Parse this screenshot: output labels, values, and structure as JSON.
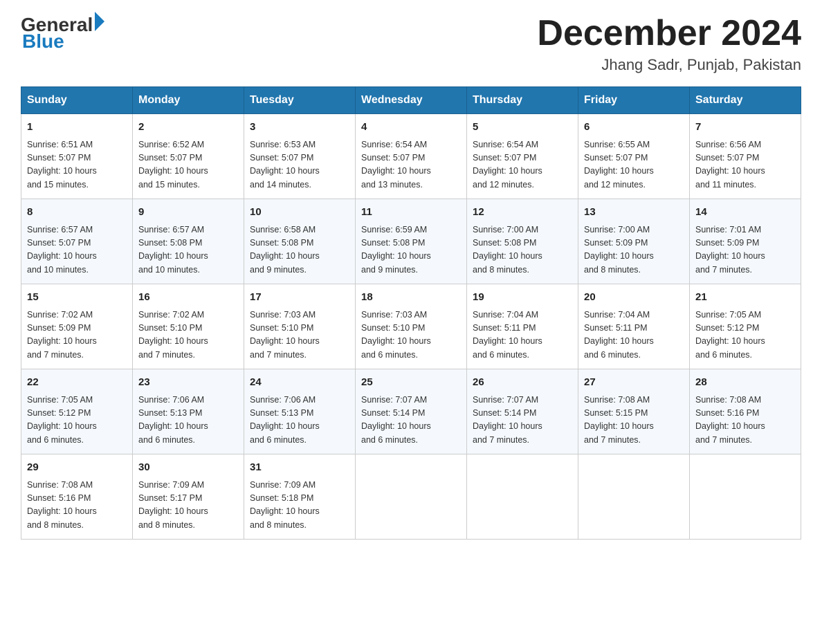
{
  "header": {
    "logo_general": "General",
    "logo_blue": "Blue",
    "month_year": "December 2024",
    "location": "Jhang Sadr, Punjab, Pakistan"
  },
  "days_of_week": [
    "Sunday",
    "Monday",
    "Tuesday",
    "Wednesday",
    "Thursday",
    "Friday",
    "Saturday"
  ],
  "weeks": [
    [
      {
        "day": "1",
        "info": "Sunrise: 6:51 AM\nSunset: 5:07 PM\nDaylight: 10 hours\nand 15 minutes."
      },
      {
        "day": "2",
        "info": "Sunrise: 6:52 AM\nSunset: 5:07 PM\nDaylight: 10 hours\nand 15 minutes."
      },
      {
        "day": "3",
        "info": "Sunrise: 6:53 AM\nSunset: 5:07 PM\nDaylight: 10 hours\nand 14 minutes."
      },
      {
        "day": "4",
        "info": "Sunrise: 6:54 AM\nSunset: 5:07 PM\nDaylight: 10 hours\nand 13 minutes."
      },
      {
        "day": "5",
        "info": "Sunrise: 6:54 AM\nSunset: 5:07 PM\nDaylight: 10 hours\nand 12 minutes."
      },
      {
        "day": "6",
        "info": "Sunrise: 6:55 AM\nSunset: 5:07 PM\nDaylight: 10 hours\nand 12 minutes."
      },
      {
        "day": "7",
        "info": "Sunrise: 6:56 AM\nSunset: 5:07 PM\nDaylight: 10 hours\nand 11 minutes."
      }
    ],
    [
      {
        "day": "8",
        "info": "Sunrise: 6:57 AM\nSunset: 5:07 PM\nDaylight: 10 hours\nand 10 minutes."
      },
      {
        "day": "9",
        "info": "Sunrise: 6:57 AM\nSunset: 5:08 PM\nDaylight: 10 hours\nand 10 minutes."
      },
      {
        "day": "10",
        "info": "Sunrise: 6:58 AM\nSunset: 5:08 PM\nDaylight: 10 hours\nand 9 minutes."
      },
      {
        "day": "11",
        "info": "Sunrise: 6:59 AM\nSunset: 5:08 PM\nDaylight: 10 hours\nand 9 minutes."
      },
      {
        "day": "12",
        "info": "Sunrise: 7:00 AM\nSunset: 5:08 PM\nDaylight: 10 hours\nand 8 minutes."
      },
      {
        "day": "13",
        "info": "Sunrise: 7:00 AM\nSunset: 5:09 PM\nDaylight: 10 hours\nand 8 minutes."
      },
      {
        "day": "14",
        "info": "Sunrise: 7:01 AM\nSunset: 5:09 PM\nDaylight: 10 hours\nand 7 minutes."
      }
    ],
    [
      {
        "day": "15",
        "info": "Sunrise: 7:02 AM\nSunset: 5:09 PM\nDaylight: 10 hours\nand 7 minutes."
      },
      {
        "day": "16",
        "info": "Sunrise: 7:02 AM\nSunset: 5:10 PM\nDaylight: 10 hours\nand 7 minutes."
      },
      {
        "day": "17",
        "info": "Sunrise: 7:03 AM\nSunset: 5:10 PM\nDaylight: 10 hours\nand 7 minutes."
      },
      {
        "day": "18",
        "info": "Sunrise: 7:03 AM\nSunset: 5:10 PM\nDaylight: 10 hours\nand 6 minutes."
      },
      {
        "day": "19",
        "info": "Sunrise: 7:04 AM\nSunset: 5:11 PM\nDaylight: 10 hours\nand 6 minutes."
      },
      {
        "day": "20",
        "info": "Sunrise: 7:04 AM\nSunset: 5:11 PM\nDaylight: 10 hours\nand 6 minutes."
      },
      {
        "day": "21",
        "info": "Sunrise: 7:05 AM\nSunset: 5:12 PM\nDaylight: 10 hours\nand 6 minutes."
      }
    ],
    [
      {
        "day": "22",
        "info": "Sunrise: 7:05 AM\nSunset: 5:12 PM\nDaylight: 10 hours\nand 6 minutes."
      },
      {
        "day": "23",
        "info": "Sunrise: 7:06 AM\nSunset: 5:13 PM\nDaylight: 10 hours\nand 6 minutes."
      },
      {
        "day": "24",
        "info": "Sunrise: 7:06 AM\nSunset: 5:13 PM\nDaylight: 10 hours\nand 6 minutes."
      },
      {
        "day": "25",
        "info": "Sunrise: 7:07 AM\nSunset: 5:14 PM\nDaylight: 10 hours\nand 6 minutes."
      },
      {
        "day": "26",
        "info": "Sunrise: 7:07 AM\nSunset: 5:14 PM\nDaylight: 10 hours\nand 7 minutes."
      },
      {
        "day": "27",
        "info": "Sunrise: 7:08 AM\nSunset: 5:15 PM\nDaylight: 10 hours\nand 7 minutes."
      },
      {
        "day": "28",
        "info": "Sunrise: 7:08 AM\nSunset: 5:16 PM\nDaylight: 10 hours\nand 7 minutes."
      }
    ],
    [
      {
        "day": "29",
        "info": "Sunrise: 7:08 AM\nSunset: 5:16 PM\nDaylight: 10 hours\nand 8 minutes."
      },
      {
        "day": "30",
        "info": "Sunrise: 7:09 AM\nSunset: 5:17 PM\nDaylight: 10 hours\nand 8 minutes."
      },
      {
        "day": "31",
        "info": "Sunrise: 7:09 AM\nSunset: 5:18 PM\nDaylight: 10 hours\nand 8 minutes."
      },
      {
        "day": "",
        "info": ""
      },
      {
        "day": "",
        "info": ""
      },
      {
        "day": "",
        "info": ""
      },
      {
        "day": "",
        "info": ""
      }
    ]
  ]
}
